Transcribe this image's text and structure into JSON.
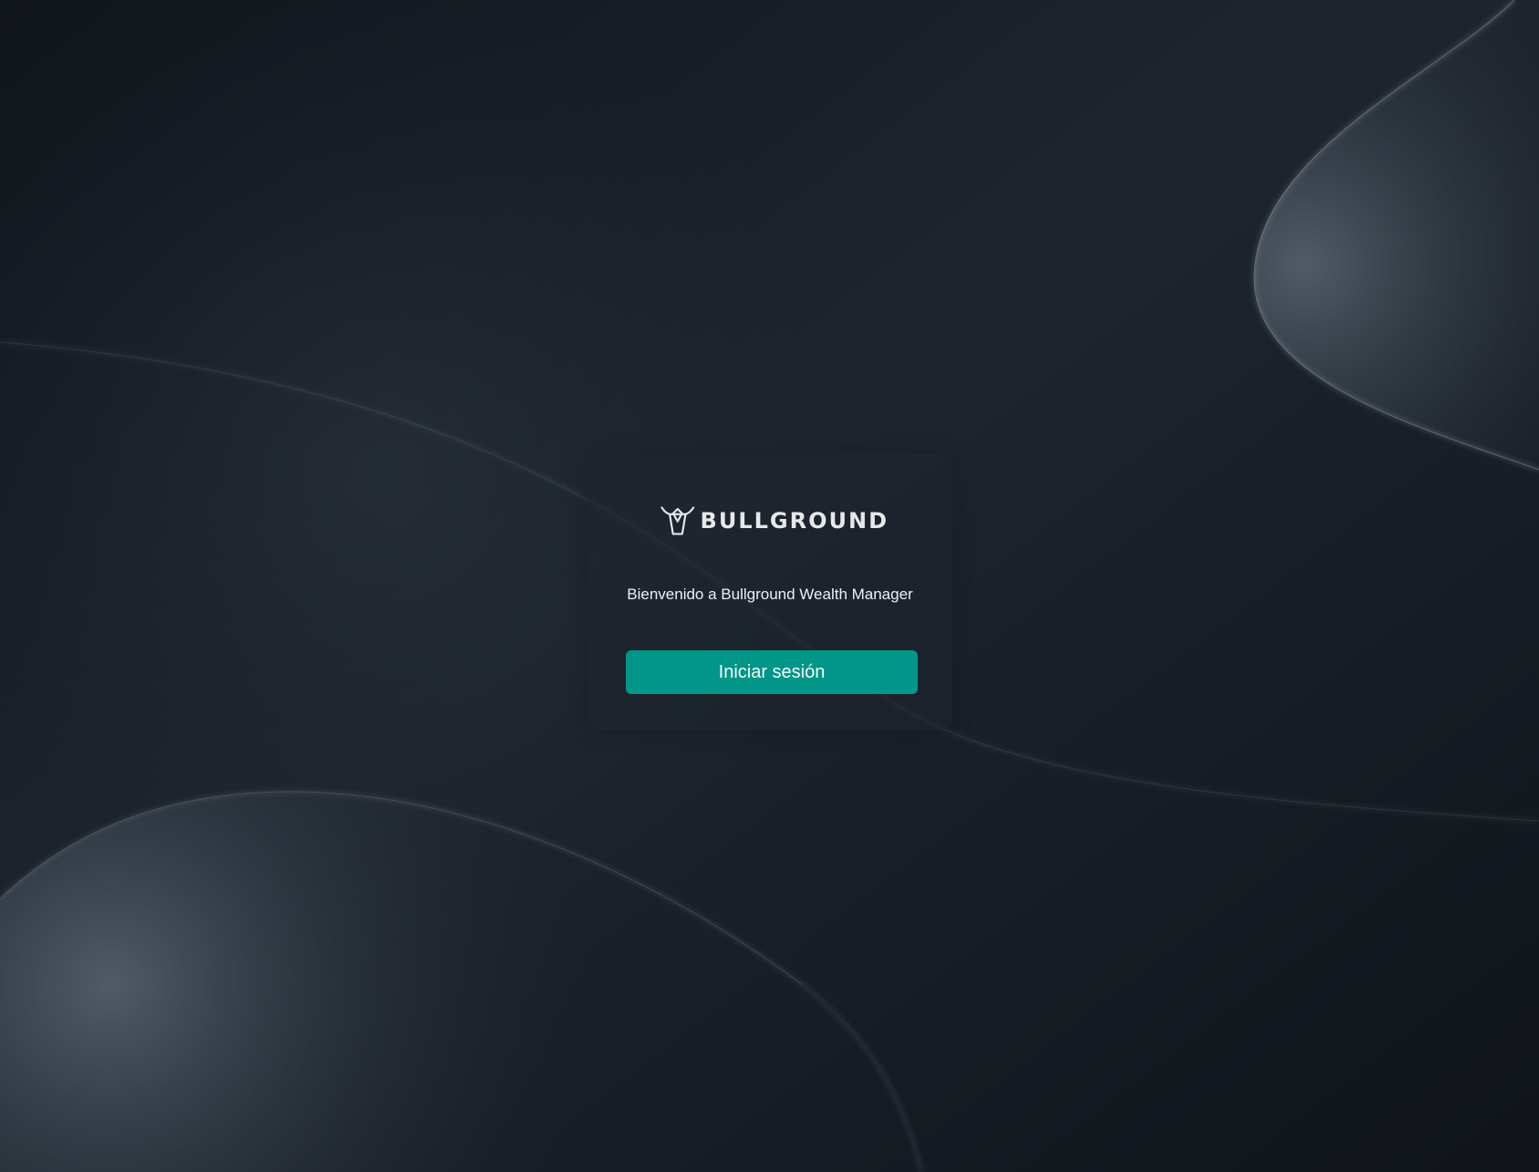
{
  "brand": {
    "logo_text": "BULLGROUND",
    "logo_icon": "bull-head-icon"
  },
  "login_card": {
    "welcome_text": "Bienvenido a Bullground Wealth Manager",
    "login_button_label": "Iniciar sesión"
  },
  "colors": {
    "background": "#1c222b",
    "accent": "#019688",
    "text": "#eef0f2"
  }
}
